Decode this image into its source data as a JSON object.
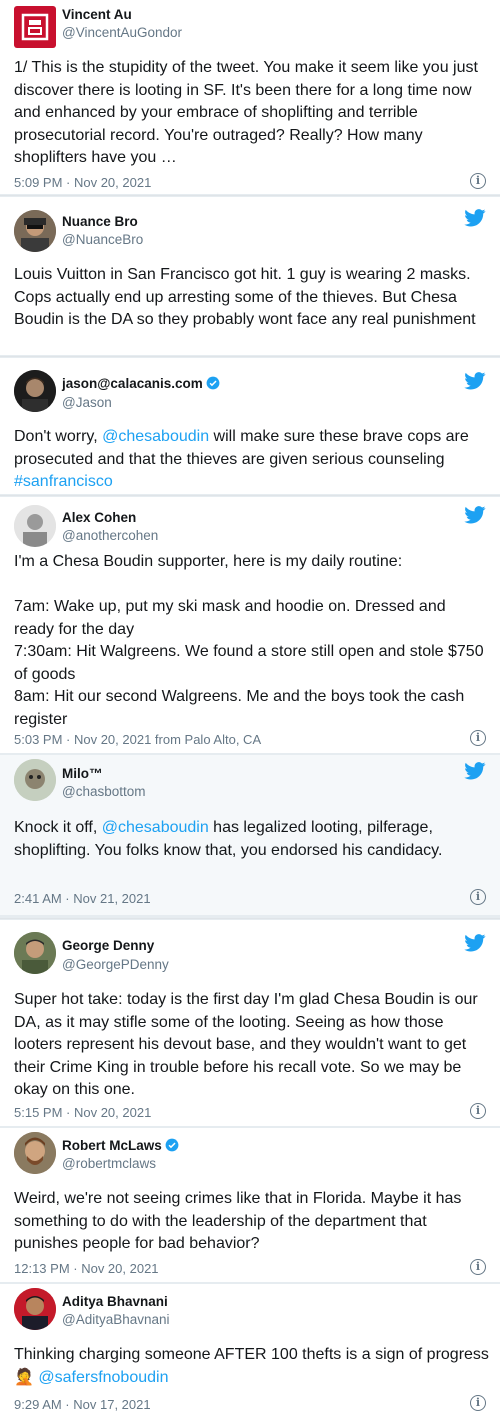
{
  "colors": {
    "link": "#1da1f2",
    "secondary": "#657786",
    "verified": "#1da1f2",
    "bird": "#1da1f2"
  },
  "tweets": [
    {
      "name": "Vincent Au",
      "handle": "@VincentAuGondor",
      "body": "1/ This is the stupidity of the tweet. You make it seem like you just discover there is looting in SF. It's been there for a long time now and enhanced by your embrace of shoplifting and terrible prosecutorial record. You're outraged? Really? How many shoplifters have you …",
      "meta": "5:09 PM · Nov 20, 2021",
      "info_icon": "info-icon"
    },
    {
      "name": "Nuance Bro",
      "handle": "@NuanceBro",
      "body": "Louis Vuitton in San Francisco got hit. 1 guy is wearing 2 masks. Cops actually end up arresting some of the thieves. But Chesa Boudin is the DA so they probably wont face any real punishment",
      "bird_icon": "twitter-bird-icon"
    },
    {
      "name": "jason@calacanis.com",
      "handle": "@Jason",
      "body_pre": "Don't worry, ",
      "mention": "@chesaboudin",
      "body_mid": " will make sure these brave cops are prosecuted and that the  thieves are given serious counseling ",
      "hashtag": "#sanfrancisco",
      "verified": true
    },
    {
      "name": "Alex Cohen",
      "handle": "@anothercohen",
      "body": "I'm a Chesa Boudin supporter, here is my daily routine:\n\n7am: Wake up, put my ski mask and hoodie on. Dressed and ready for the day\n7:30am: Hit Walgreens. We found a store still open and stole $750 of goods\n8am: Hit our second Walgreens. Me and the boys took the cash register",
      "meta": "5:03 PM · Nov 20, 2021 from Palo Alto, CA"
    },
    {
      "name": "Milo™",
      "handle": "@chasbottom",
      "body_pre": "Knock it off, ",
      "mention": "@chesaboudin",
      "body_post": " has legalized looting, pilferage, shoplifting. You folks know that, you endorsed his candidacy.",
      "meta": "2:41 AM · Nov 21, 2021"
    },
    {
      "name": "George Denny",
      "handle": "@GeorgePDenny",
      "body": "Super hot take: today is the first day I'm glad Chesa Boudin is our DA, as it may stifle some of the looting. Seeing as how those looters represent his devout base, and they wouldn't want to get their Crime King in trouble before his recall vote. So we may be okay on this one.",
      "meta": "5:15 PM · Nov 20, 2021"
    },
    {
      "name": "Robert McLaws",
      "handle": "@robertmclaws",
      "verified": true,
      "body": "Weird, we're not seeing crimes like that in Florida. Maybe it has something to do with the leadership of the department that punishes people for bad behavior?",
      "meta": "12:13 PM · Nov 20, 2021"
    },
    {
      "name": "Aditya Bhavnani",
      "handle": "@AdityaBhavnani",
      "body_pre": "Thinking charging someone AFTER 100 thefts is a sign of progress ",
      "emoji": "🤦",
      "mention": "@safersfnoboudin",
      "meta": "9:29 AM · Nov 17, 2021"
    }
  ]
}
